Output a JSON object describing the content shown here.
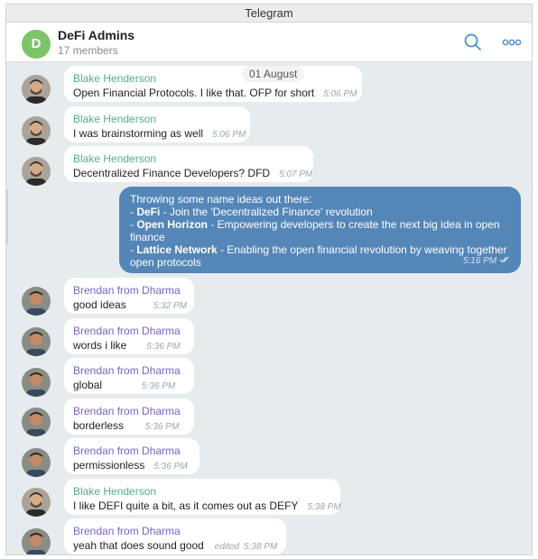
{
  "window": {
    "title": "Telegram"
  },
  "header": {
    "avatar_letter": "D",
    "chat_name": "DeFi Admins",
    "members": "17 members",
    "icons": [
      "search-icon",
      "more-icon"
    ]
  },
  "colors": {
    "accent": "#5486b8",
    "blake": "#4fae8e",
    "brendan": "#7d62c7",
    "group_avatar": "#7cc36a"
  },
  "date_separator": "01 August",
  "messages": [
    {
      "sender": "Blake Henderson",
      "text": "Open Financial Protocols. I like that. OFP for short",
      "time": "5:06 PM"
    },
    {
      "sender": "Blake Henderson",
      "text": "I was brainstorming as well",
      "time": "5:06 PM"
    },
    {
      "sender": "Blake Henderson",
      "text": "Decentralized Finance Developers? DFD",
      "time": "5:07 PM"
    },
    {
      "sender": "Brendan from Dharma",
      "text": "good ideas",
      "time": "5:32 PM"
    },
    {
      "sender": "Brendan from Dharma",
      "text": "words i like",
      "time": "5:36 PM"
    },
    {
      "sender": "Brendan from Dharma",
      "text": "global",
      "time": "5:36 PM"
    },
    {
      "sender": "Brendan from Dharma",
      "text": "borderless",
      "time": "5:36 PM"
    },
    {
      "sender": "Brendan from Dharma",
      "text": "permissionless",
      "time": "5:36 PM"
    },
    {
      "sender": "Blake Henderson",
      "text": "I like DEFI quite a bit, as it comes out as DEFY",
      "time": "5:38 PM"
    },
    {
      "sender": "Brendan from Dharma",
      "text": "yeah that does sound good",
      "edited": "edited",
      "time": "5:38 PM"
    }
  ],
  "outgoing": {
    "intro": "Throwing some name ideas out there:",
    "line1_name": "DeFi",
    "line1_desc": " - Join the 'Decentralized Finance' revolution",
    "line2_name": "Open Horizon",
    "line2_desc": " - Empowering developers to create the next big idea in open",
    "line2_cont": "finance",
    "line3_name": "Lattice Network",
    "line3_desc": " - Enabling the open financial revolution by weaving together",
    "line3_cont": "open protocols",
    "time": "5:16 PM"
  }
}
